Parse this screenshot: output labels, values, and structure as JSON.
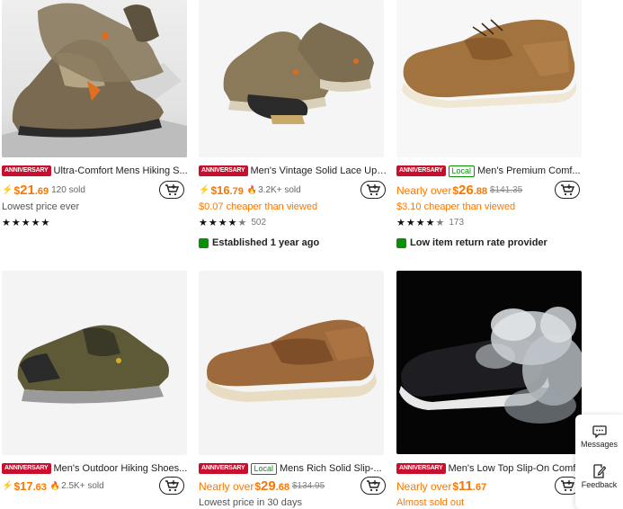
{
  "products": [
    {
      "badge": "ANNIVERSARY",
      "title": "Ultra-Comfort Mens Hiking S...",
      "price_symbol": "$",
      "price_main": "21",
      "price_cents": ".69",
      "sold": "120 sold",
      "note": "Lowest price ever",
      "rating": 5
    },
    {
      "badge": "ANNIVERSARY",
      "title": "Men's Vintage Solid Lace Up ...",
      "price_symbol": "$",
      "price_main": "16",
      "price_cents": ".79",
      "sold": "3.2K+ sold",
      "note": "$0.07 cheaper than viewed",
      "rating": 4.5,
      "reviews": "502",
      "trust": "Established 1 year ago"
    },
    {
      "badge": "ANNIVERSARY",
      "local": "Local",
      "title": "Men's Premium Comf...",
      "price_prefix": "Nearly over",
      "price_symbol": "$",
      "price_main": "26",
      "price_cents": ".88",
      "strike": "$141.35",
      "note": "$3.10 cheaper than viewed",
      "rating": 4.5,
      "reviews": "173",
      "trust": "Low item return rate provider"
    },
    {
      "badge": "ANNIVERSARY",
      "title": "Men's Outdoor Hiking Shoes...",
      "price_symbol": "$",
      "price_main": "17",
      "price_cents": ".63",
      "sold": "2.5K+ sold"
    },
    {
      "badge": "ANNIVERSARY",
      "local": "Local",
      "title": "Mens Rich Solid Slip-...",
      "price_prefix": "Nearly over",
      "price_symbol": "$",
      "price_main": "29",
      "price_cents": ".68",
      "strike": "$134.95",
      "note": "Lowest price in 30 days"
    },
    {
      "badge": "ANNIVERSARY",
      "title": "Men's Low Top Slip-On Comf...",
      "price_prefix": "Nearly over",
      "price_symbol": "$",
      "price_main": "11",
      "price_cents": ".67",
      "note": "Almost sold out"
    }
  ],
  "sidebar": {
    "messages": "Messages",
    "feedback": "Feedback"
  },
  "colors": {
    "accent": "#fb7701",
    "badge": "#c8102e",
    "local": "#0a8f08"
  }
}
